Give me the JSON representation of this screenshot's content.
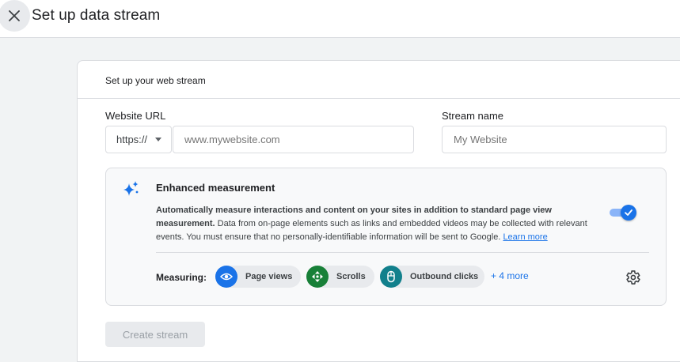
{
  "header": {
    "title": "Set up data stream",
    "close_icon": "close-icon"
  },
  "card": {
    "title": "Set up your web stream",
    "website_url": {
      "label": "Website URL",
      "protocol": "https://",
      "placeholder": "www.mywebsite.com"
    },
    "stream_name": {
      "label": "Stream name",
      "placeholder": "My Website"
    },
    "enhanced_measurement": {
      "icon": "sparkle-icon",
      "title": "Enhanced measurement",
      "description_bold": "Automatically measure interactions and content on your sites in addition to standard page view measurement.",
      "description": "Data from on-page elements such as links and embedded videos may be collected with relevant events. You must ensure that no personally-identifiable information will be sent to Google.",
      "learn_more": "Learn more",
      "toggle_on": true,
      "measuring_label": "Measuring:",
      "chips": [
        {
          "label": "Page views",
          "icon": "eye-icon",
          "color": "#1a73e8"
        },
        {
          "label": "Scrolls",
          "icon": "scroll-arrows-icon",
          "color": "#188038"
        },
        {
          "label": "Outbound clicks",
          "icon": "mouse-icon",
          "color": "#12808c"
        }
      ],
      "more": "+ 4 more",
      "settings_icon": "gear-icon"
    },
    "create_button": "Create stream"
  },
  "colors": {
    "accent": "#1a73e8",
    "toggle_track": "#8ab4f8",
    "disabled_text": "#9aa0a6"
  }
}
